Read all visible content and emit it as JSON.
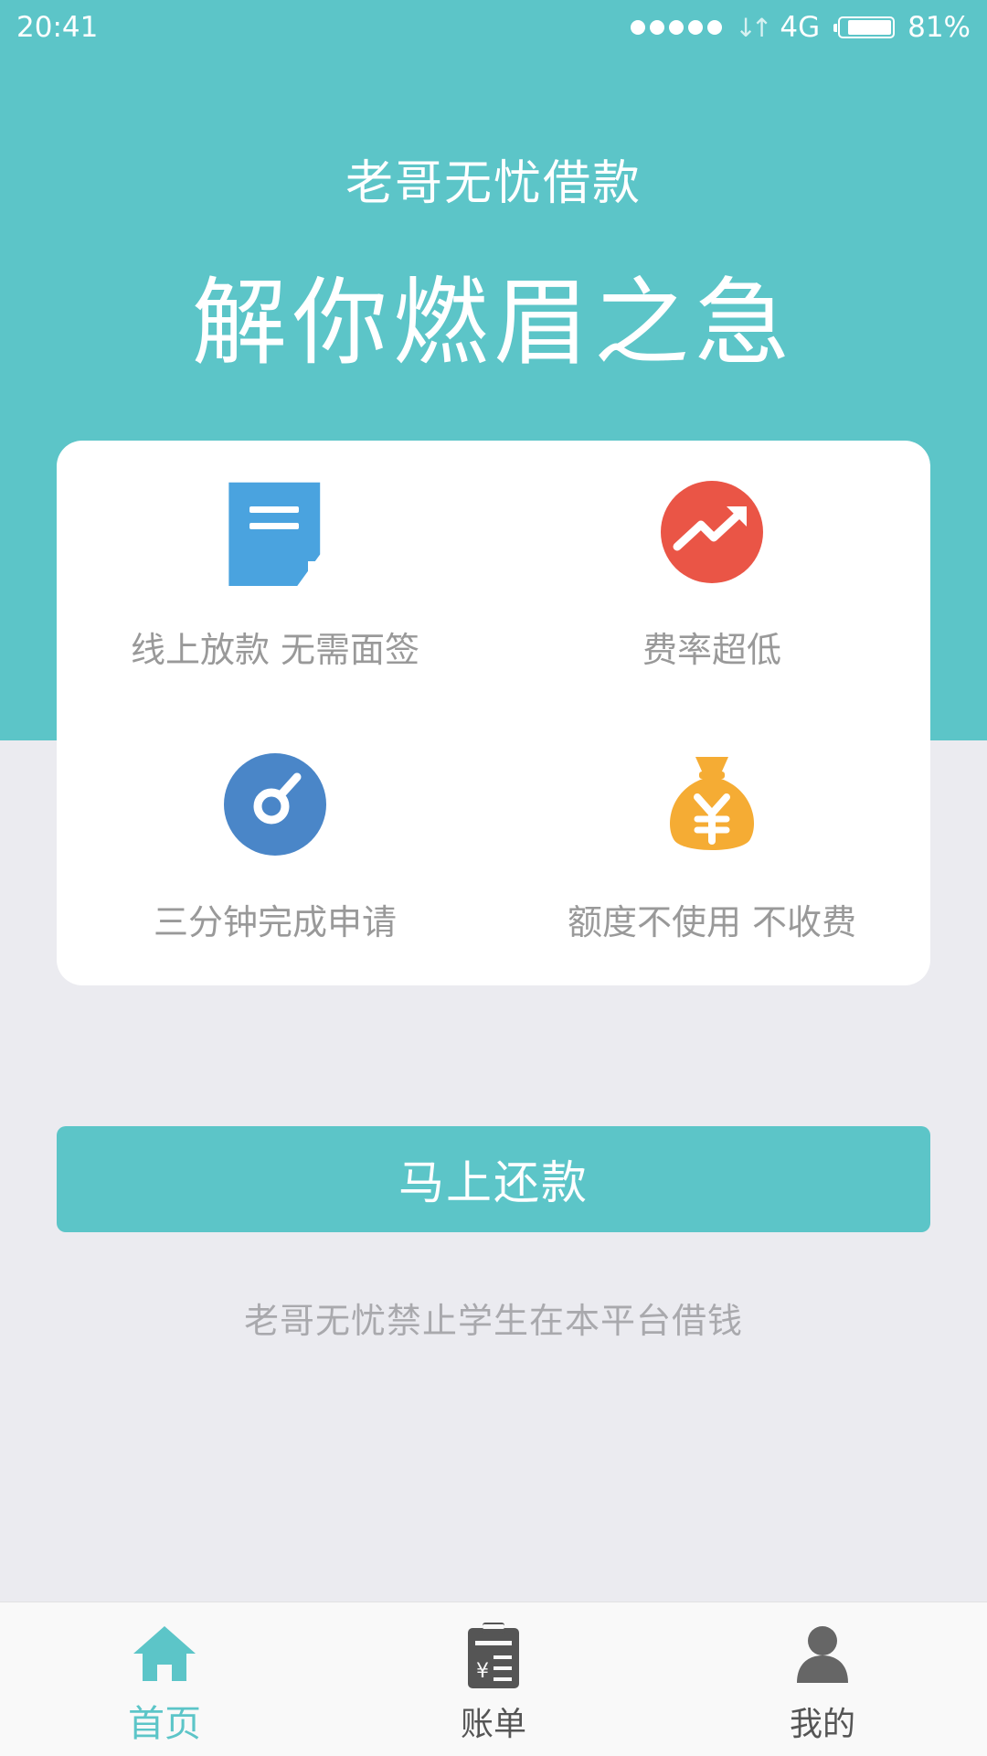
{
  "status_bar": {
    "time": "20:41",
    "network": "4G",
    "battery": "81%",
    "battery_level": 0.81
  },
  "hero": {
    "app_title": "老哥无忧借款",
    "slogan": "解你燃眉之急"
  },
  "features": [
    {
      "label": "线上放款 无需面签",
      "icon": "document-icon",
      "color": "#4aa3df"
    },
    {
      "label": "费率超低",
      "icon": "trend-up-icon",
      "color": "#ea5546"
    },
    {
      "label": "三分钟完成申请",
      "icon": "gauge-icon",
      "color": "#4a86c8"
    },
    {
      "label": "额度不使用 不收费",
      "icon": "money-bag-icon",
      "color": "#f5ac34"
    }
  ],
  "repay_button": {
    "label": "马上还款"
  },
  "notice": "老哥无忧禁止学生在本平台借钱",
  "tabs": [
    {
      "label": "首页",
      "icon": "home-icon",
      "active": true
    },
    {
      "label": "账单",
      "icon": "bill-icon",
      "active": false
    },
    {
      "label": "我的",
      "icon": "user-icon",
      "active": false
    }
  ],
  "colors": {
    "brand": "#5cc5c8",
    "background": "#ebebf0",
    "tab_inactive": "#555555"
  }
}
